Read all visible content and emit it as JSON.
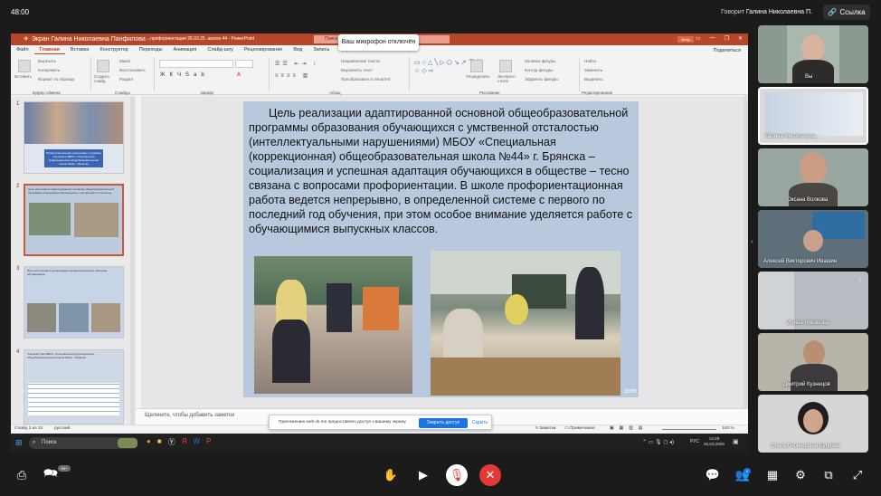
{
  "call": {
    "time": "48:00",
    "speaking_prefix": "Говорит",
    "speaking_name": "Галина Николаевна П.",
    "link_label": "Ссылка",
    "mic_tooltip": "Ваш микрофон отключён",
    "chat_badge": "99+",
    "participants_badge": "8"
  },
  "ppt": {
    "share_label": "Экран Галина Николаевна Панфилова",
    "doc_title": "...профориентация 26.03.25. школа 44 - PowerPoint",
    "search_placeholder": "Поиск",
    "signin": "Вход",
    "share": "Поделиться",
    "tabs": [
      "Файл",
      "Главная",
      "Вставка",
      "Конструктор",
      "Переходы",
      "Анимация",
      "Слайд-шоу",
      "Рецензирование",
      "Вид",
      "Запись",
      "Справка"
    ],
    "ribbon": {
      "paste": "Вставить",
      "cut": "Вырезать",
      "copy": "Копировать",
      "format": "Формат по образцу",
      "new_slide": "Создать слайд",
      "layout": "Макет",
      "reset": "Восстановить",
      "section": "Раздел",
      "text_dir": "Направление текста",
      "align_text": "Выровнять текст",
      "smartart": "Преобразовать в SmartArt",
      "arrange": "Упорядочить",
      "quick_styles": "Экспресс-стили",
      "fill": "Заливка фигуры",
      "outline": "Контур фигуры",
      "effects": "Эффекты фигуры",
      "find": "Найти",
      "replace": "Заменить",
      "select": "Выделить",
      "groups": [
        "Буфер обмена",
        "Слайды",
        "Шрифт",
        "Абзац",
        "Рисование",
        "Редактирование"
      ]
    },
    "slides": [
      {
        "num": "1",
        "text": "Профессиональная ориентация и трудовое обучение в МБОУ «Специальная (коррекционная) общеобразовательная школа №44» г. Брянска"
      },
      {
        "num": "2",
        "text": "Цель реализации адаптированной основной общеобразовательной программы образования обучающихся с умственной отсталостью"
      },
      {
        "num": "3",
        "text": "При поступлении в организацию профессионального обучения обучающиеся..."
      },
      {
        "num": "4",
        "text": "Учебный план МБОУ «Специальная (коррекционная) общеобразовательная школа №44» г. Брянска"
      }
    ],
    "slide_text": "Цель реализации адаптированной основной общеобразовательной программы образования обучающихся с умственной отсталостью (интеллектуальными нарушениями) МБОУ «Специальная (коррекционная) общеобразовательная школа №44» г. Брянска – социализация и успешная адаптация обучающихся в обществе – тесно связана с вопросами профориентации. В школе профориентационная работа ведется непрерывно, в определенной системе с первого по последний год обучения, при этом особое внимание уделяется работе с обучающимися выпускных классов.",
    "watermark": ".com",
    "notes_placeholder": "Щелкните, чтобы добавить заметки",
    "status": {
      "slide": "Слайд 2 из 24",
      "lang": "русский",
      "notes": "Заметки",
      "comments": "Примечания",
      "zoom": "100 %"
    },
    "toast": {
      "text": "Приложению web.vk.me предоставлен доступ к вашему экрану.",
      "button": "Закрыть доступ",
      "hide": "Скрыть"
    },
    "taskbar": {
      "search": "Поиск",
      "lang": "РУС",
      "time": "14:28",
      "date": "26.03.2025"
    }
  },
  "participants": [
    {
      "name": "Вы",
      "bg": "#8a9a8f"
    },
    {
      "name": "Галина Николаевна...",
      "bg": "#d9d9d9"
    },
    {
      "name": "Оксана Волкова",
      "bg": "#9aa6a0"
    },
    {
      "name": "Алексей Викторович Ивашин",
      "bg": "#5f6f7a"
    },
    {
      "name": "Ирина Никанова",
      "bg": "#b6bcc2"
    },
    {
      "name": "Дмитрий Кузнецов",
      "bg": "#b9b4aa"
    },
    {
      "name": "Ольга Леонидовна Бурцева",
      "bg": "#d8d6d4"
    }
  ],
  "colors": {
    "ppt_accent": "#b7472a",
    "end_call": "#e53935",
    "share_active": "#1a73e8"
  }
}
